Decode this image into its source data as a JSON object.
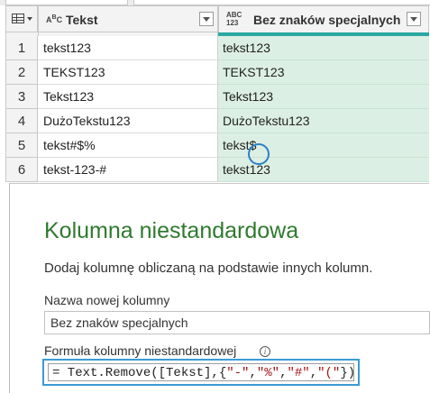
{
  "grid": {
    "columns": [
      {
        "type_icon": "ABC",
        "label": "Tekst"
      },
      {
        "type_icon_top": "ABC",
        "type_icon_bottom": "123",
        "label": "Bez znaków specjalnych"
      }
    ],
    "rows": [
      {
        "num": "1",
        "tekst": "tekst123",
        "bez": "tekst123"
      },
      {
        "num": "2",
        "tekst": "TEKST123",
        "bez": "TEKST123"
      },
      {
        "num": "3",
        "tekst": "Tekst123",
        "bez": "Tekst123"
      },
      {
        "num": "4",
        "tekst": "DużoTekstu123",
        "bez": "DużoTekstu123"
      },
      {
        "num": "5",
        "tekst": "tekst#$%",
        "bez": "tekst$"
      },
      {
        "num": "6",
        "tekst": "tekst-123-#",
        "bez": "tekst123"
      }
    ]
  },
  "dialog": {
    "title": "Kolumna niestandardowa",
    "description": "Dodaj kolumnę obliczaną na podstawie innych kolumn.",
    "name_label": "Nazwa nowej kolumny",
    "name_value": "Bez znaków specjalnych",
    "formula_label": "Formuła kolumny niestandardowej",
    "formula_prefix": "= Text.Remove([Tekst],{",
    "formula_s1": "\"-\"",
    "formula_c1": ",",
    "formula_s2": "\"%\"",
    "formula_c2": ",",
    "formula_s3": "\"#\"",
    "formula_c3": ",",
    "formula_s4": "\"(\"",
    "formula_suffix": "})"
  },
  "colors": {
    "accent_teal": "#2aa8a0",
    "title_green": "#2f7a2f",
    "highlight_blue": "#3a9bd4",
    "cell_green": "#dcefe4"
  },
  "icons": [
    "table-icon",
    "abc-type-icon",
    "abc123-type-icon",
    "filter-dropdown-icon",
    "info-icon"
  ]
}
